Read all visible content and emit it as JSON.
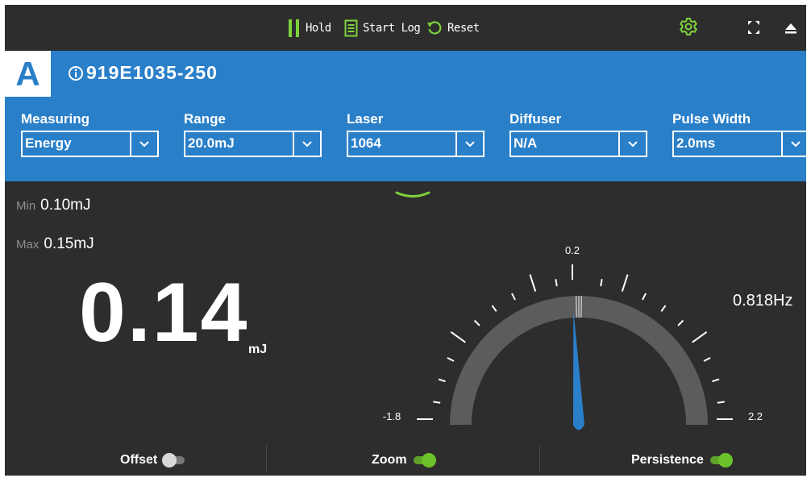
{
  "toolbar": {
    "hold_label": "Hold",
    "start_log_label": "Start Log",
    "reset_label": "Reset",
    "icons": [
      "pause-icon",
      "log-icon",
      "reset-icon",
      "gear-icon",
      "fullscreen-icon",
      "eject-icon"
    ]
  },
  "device": {
    "channel": "A",
    "name": "919E1035-250"
  },
  "settings": [
    {
      "label": "Measuring",
      "value": "Energy"
    },
    {
      "label": "Range",
      "value": "20.0mJ"
    },
    {
      "label": "Laser",
      "value": "1064"
    },
    {
      "label": "Diffuser",
      "value": "N/A"
    },
    {
      "label": "Pulse Width",
      "value": "2.0ms"
    }
  ],
  "readout": {
    "min_label": "Min",
    "min_value": "0.10mJ",
    "max_label": "Max",
    "max_value": "0.15mJ",
    "value": "0.14",
    "unit": "mJ",
    "frequency": "0.818Hz"
  },
  "gauge": {
    "min_label": "-1.8",
    "max_label": "2.2",
    "center_label": "0.2",
    "min": -1.8,
    "max": 2.2,
    "needle_value": 0.14
  },
  "bottom": {
    "offset_label": "Offset",
    "offset_on": false,
    "zoom_label": "Zoom",
    "zoom_on": true,
    "persistence_label": "Persistence",
    "persistence_on": true
  },
  "colors": {
    "accent_blue": "#2a7fc9",
    "accent_green": "#6cc22a",
    "background": "#2d2d2d"
  }
}
